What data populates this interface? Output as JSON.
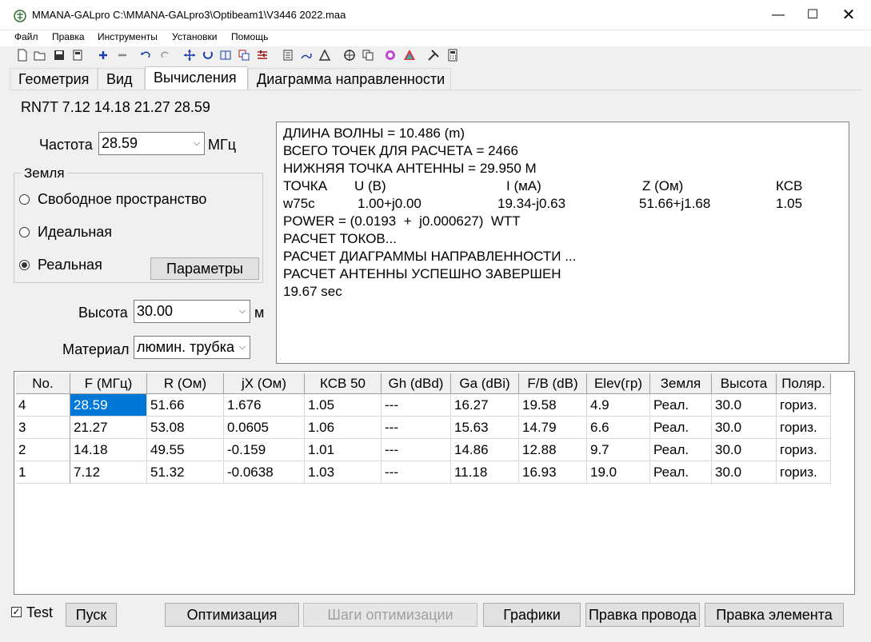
{
  "window": {
    "title": "MMANA-GALpro C:\\MMANA-GALpro3\\Optibeam1\\V3446 2022.maa",
    "minimize_glyph": "—",
    "maximize_glyph": "☐",
    "close_glyph": "✕"
  },
  "menu": [
    "Файл",
    "Правка",
    "Инструменты",
    "Установки",
    "Помощь"
  ],
  "toolbar_icons": [
    "new-file-icon",
    "open-file-icon",
    "save-icon",
    "save-as-icon",
    "add-icon",
    "remove-icon",
    "undo-icon",
    "redo-icon",
    "move-icon",
    "rotate-icon",
    "stretch-icon",
    "copy-element-icon",
    "settings-sliders-icon",
    "notes-icon",
    "draw-icon",
    "triangle-icon",
    "target-icon",
    "copy-icon",
    "palette-icon",
    "pattern-3d-icon",
    "tools-icon",
    "calculator-icon"
  ],
  "tabs": [
    "Геометрия",
    "Вид",
    "Вычисления",
    "Диаграмма направленности"
  ],
  "active_tab": "Вычисления",
  "antenna_title": "RN7T 7.12 14.18 21.27 28.59",
  "frequency": {
    "label": "Частота",
    "value": "28.59",
    "unit": "МГц"
  },
  "ground": {
    "title": "Земля",
    "options": [
      "Свободное пространство",
      "Идеальная",
      "Реальная"
    ],
    "selected": "Реальная",
    "params_button": "Параметры"
  },
  "height": {
    "label": "Высота",
    "value": "30.00",
    "unit": "м"
  },
  "material": {
    "label": "Материал",
    "value": "люмин. трубка"
  },
  "output_lines": [
    "ДЛИНА ВОЛНЫ = 10.486 (m)",
    "ВСЕГО ТОЧЕК ДЛЯ РАСЧЕТА = 2466",
    "НИЖНЯЯ ТОЧКА АНТЕННЫ = 29.950 М",
    "POWER = (0.0193  +  j0.000627)  WTT",
    "РАСЧЕТ ТОКОВ...",
    "РАСЧЕТ ДИАГРАММЫ НАПРАВЛЕННОСТИ ...",
    "РАСЧЕТ АНТЕННЫ УСПЕШНО ЗАВЕРШЕН",
    "19.67 sec"
  ],
  "point_table": {
    "headers": [
      "ТОЧКА",
      "U (В)",
      "I (мА)",
      "Z (Ом)",
      "КСВ"
    ],
    "row": [
      "w75c",
      "1.00+j0.00",
      "19.34-j0.63",
      "51.66+j1.68",
      "1.05"
    ]
  },
  "results": {
    "headers": [
      "No.",
      "F (МГц)",
      "R (Ом)",
      "jX (Ом)",
      "КСВ 50",
      "Gh (dBd)",
      "Ga (dBi)",
      "F/B (dB)",
      "Elev(гр)",
      "Земля",
      "Высота",
      "Поляр."
    ],
    "rows": [
      [
        "4",
        "28.59",
        "51.66",
        "1.676",
        "1.05",
        "---",
        "16.27",
        "19.58",
        "4.9",
        "Реал.",
        "30.0",
        "гориз."
      ],
      [
        "3",
        "21.27",
        "53.08",
        "0.0605",
        "1.06",
        "---",
        "15.63",
        "14.79",
        "6.6",
        "Реал.",
        "30.0",
        "гориз."
      ],
      [
        "2",
        "14.18",
        "49.55",
        "-0.159",
        "1.01",
        "---",
        "14.86",
        "12.88",
        "9.7",
        "Реал.",
        "30.0",
        "гориз."
      ],
      [
        "1",
        "7.12",
        "51.32",
        "-0.0638",
        "1.03",
        "---",
        "11.18",
        "16.93",
        "19.0",
        "Реал.",
        "30.0",
        "гориз."
      ]
    ]
  },
  "bottom": {
    "test_label": "Test",
    "test_checked": true,
    "check_glyph": "✓",
    "start_button": "Пуск",
    "optimize_button": "Оптимизация",
    "opt_steps_button": "Шаги оптимизации",
    "graphs_button": "Графики",
    "edit_wire_button": "Правка провода",
    "edit_element_button": "Правка элемента"
  },
  "colors": {
    "selection": "#0078d7",
    "window_bg": "#f0f0f0"
  }
}
